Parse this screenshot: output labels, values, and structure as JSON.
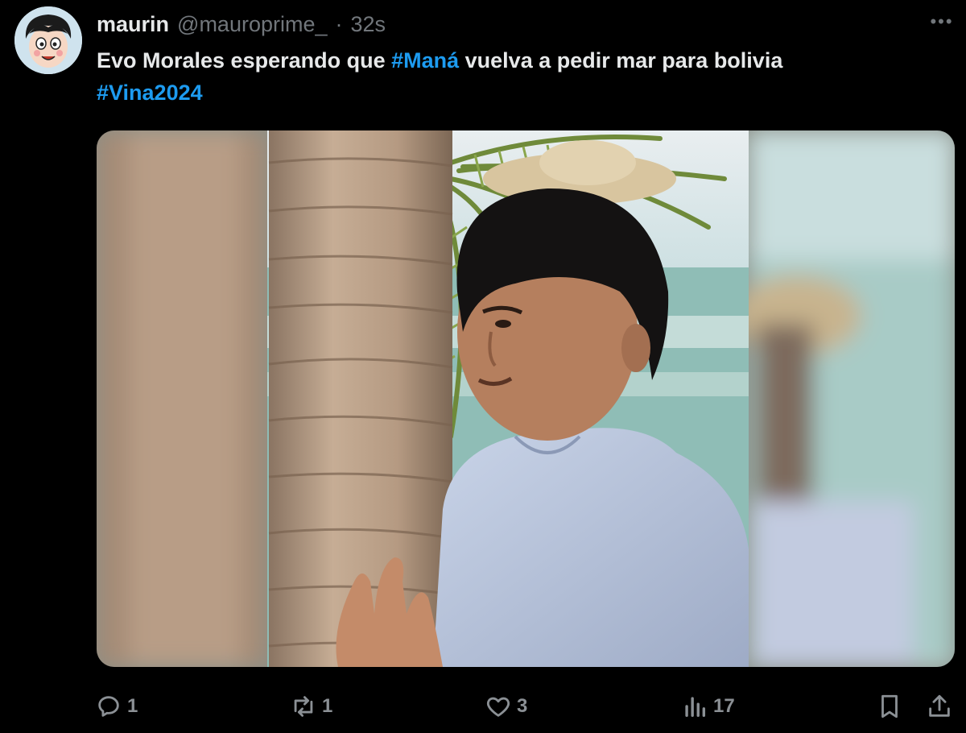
{
  "tweet": {
    "display_name": "maurin",
    "handle": "@mauroprime_",
    "separator": "·",
    "timestamp": "32s",
    "text": {
      "part1": "Evo Morales esperando que ",
      "hashtag1": "#Maná",
      "part2": " vuelva a pedir mar para bolivia",
      "hashtag2": "#Vina2024"
    },
    "more_label": "•••"
  },
  "actions": {
    "replies": "1",
    "reposts": "1",
    "likes": "3",
    "views": "17"
  },
  "icons": {
    "avatar": "cartoon-avatar",
    "more": "more-dots-icon",
    "reply": "reply-icon",
    "repost": "repost-icon",
    "like": "heart-icon",
    "views": "views-chart-icon",
    "bookmark": "bookmark-icon",
    "share": "share-icon"
  },
  "colors": {
    "background": "#000000",
    "text_primary": "#e7e9ea",
    "text_secondary": "#71767b",
    "link": "#1d9bf0"
  }
}
